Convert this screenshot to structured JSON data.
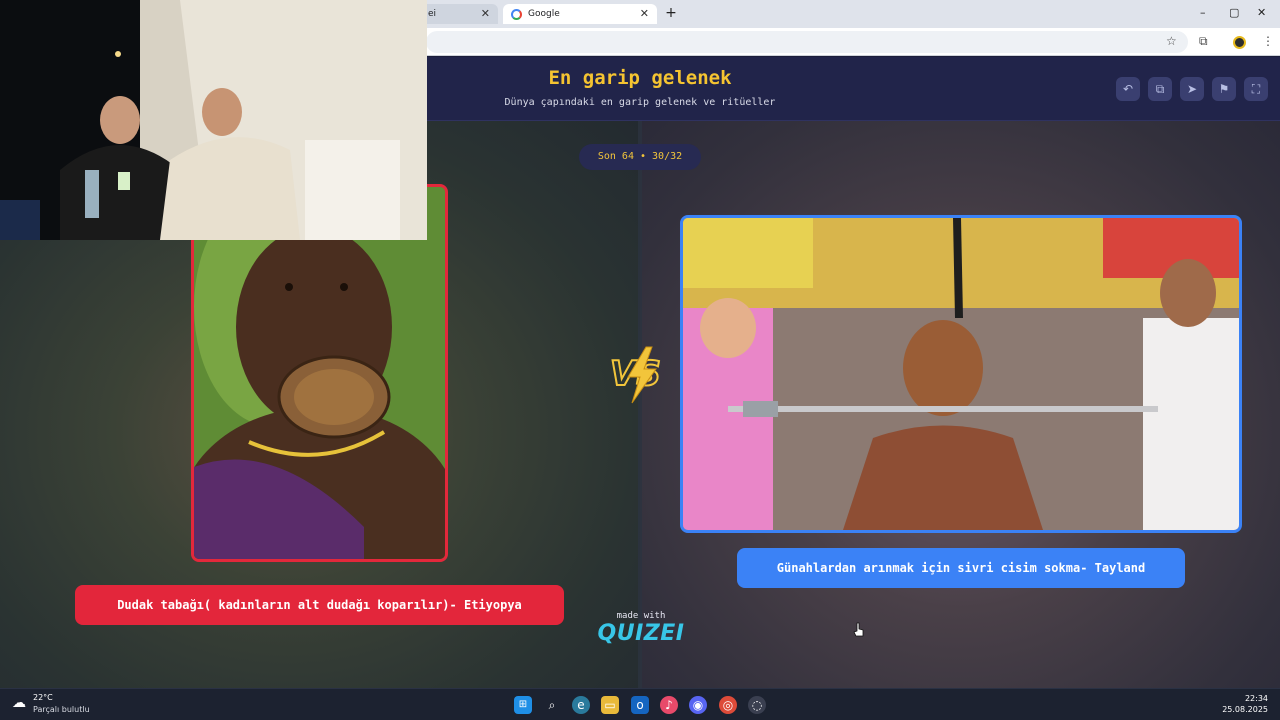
{
  "browser": {
    "tabs": [
      {
        "label": "ei",
        "active": false
      },
      {
        "label": "Google",
        "active": true
      }
    ],
    "new_tab_label": "+",
    "window_controls": {
      "minimize": "–",
      "maximize": "▢",
      "close": "✕"
    },
    "toolbar_icons": [
      "star-icon",
      "extensions-icon",
      "profile-icon",
      "menu-icon"
    ]
  },
  "header": {
    "title": "En garip gelenek",
    "subtitle": "Dünya çapındaki en garip gelenek ve ritüeller",
    "buttons": [
      "undo-icon",
      "copy-icon",
      "send-icon",
      "flag-icon",
      "fullscreen-icon"
    ]
  },
  "round": {
    "label": "Son 64 • 30/32"
  },
  "left_option": {
    "label": "Dudak tabağı( kadınların alt dudağı koparılır)- Etiyopya",
    "accent": "#e3283b"
  },
  "right_option": {
    "label": "Günahlardan arınmak için sivri cisim sokma- Tayland",
    "accent": "#3b82f6"
  },
  "vs": {
    "text": "VS"
  },
  "branding": {
    "made_with": "made with",
    "brand": "QUIZEI"
  },
  "taskbar": {
    "weather": {
      "temp": "22°C",
      "desc": "Parçalı bulutlu"
    },
    "apps": [
      "windows-start-icon",
      "search-icon",
      "edge-icon",
      "file-explorer-icon",
      "outlook-icon",
      "music-icon",
      "discord-icon",
      "chrome-icon",
      "app-icon"
    ],
    "clock": {
      "time": "22:34",
      "date": "25.08.2025"
    }
  },
  "colors": {
    "accent_yellow": "#f5c431",
    "bg": "#242548",
    "red": "#e3283b",
    "blue": "#3b82f6"
  }
}
